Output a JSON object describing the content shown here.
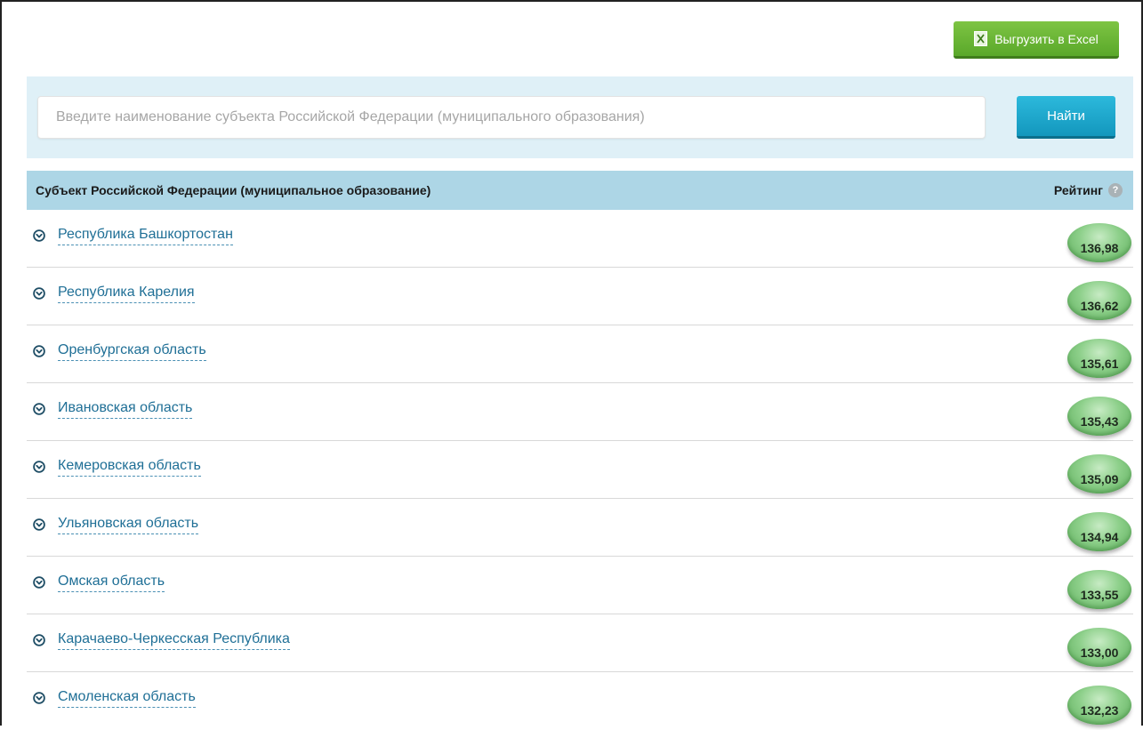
{
  "toolbar": {
    "export_label": "Выгрузить в Excel"
  },
  "search": {
    "placeholder": "Введите наименование субъекта Российской Федерации (муниципального образования)",
    "button_label": "Найти"
  },
  "table": {
    "col_subject": "Субъект Российской Федерации (муниципальное образование)",
    "col_rating": "Рейтинг",
    "rows": [
      {
        "name": "Республика Башкортостан",
        "rating": "136,98"
      },
      {
        "name": "Республика Карелия",
        "rating": "136,62"
      },
      {
        "name": "Оренбургская область",
        "rating": "135,61"
      },
      {
        "name": "Ивановская область",
        "rating": "135,43"
      },
      {
        "name": "Кемеровская область",
        "rating": "135,09"
      },
      {
        "name": "Ульяновская область",
        "rating": "134,94"
      },
      {
        "name": "Омская область",
        "rating": "133,55"
      },
      {
        "name": "Карачаево-Черкесская Республика",
        "rating": "133,00"
      },
      {
        "name": "Смоленская область",
        "rating": "132,23"
      }
    ]
  },
  "icons": {
    "export": "excel-icon",
    "help": "help-icon",
    "row_expand": "chevron-down-circle-icon"
  },
  "colors": {
    "export_button": "#6bb636",
    "find_button": "#1ea9cf",
    "search_band": "#dff0f7",
    "table_header": "#add6e6",
    "link": "#1f6f96",
    "rating_badge": "#8ccf89"
  }
}
